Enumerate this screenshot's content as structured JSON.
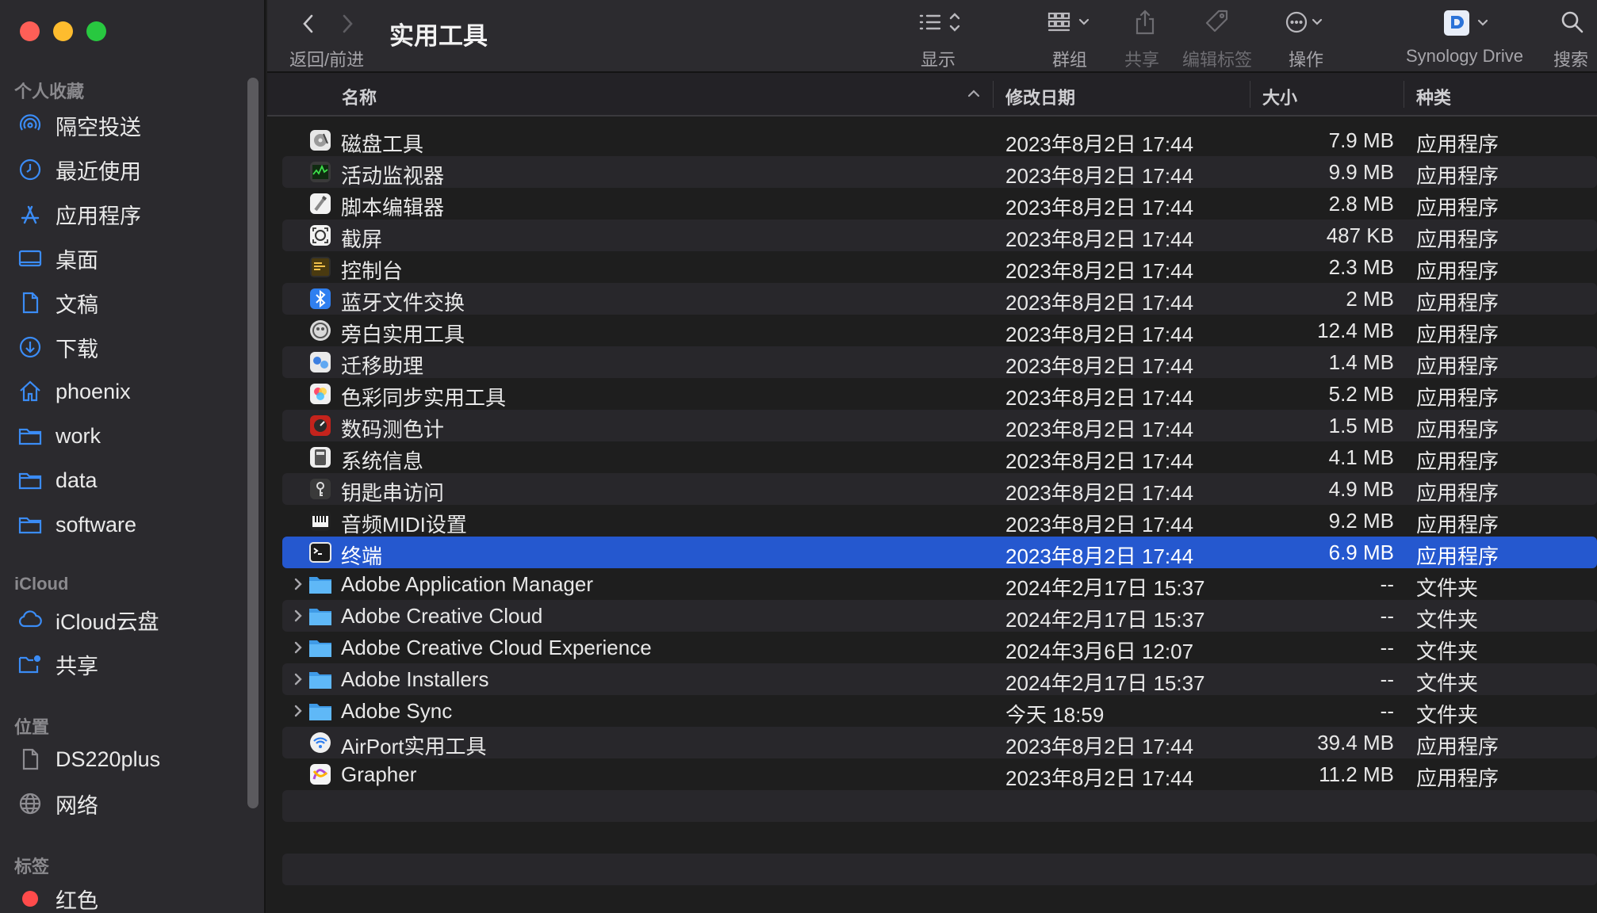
{
  "window": {
    "title": "实用工具",
    "controls": [
      "close",
      "minimize",
      "zoom"
    ]
  },
  "sidebar": {
    "sections": [
      {
        "title": "个人收藏",
        "items": [
          {
            "label": "隔空投送",
            "icon": "airdrop-icon"
          },
          {
            "label": "最近使用",
            "icon": "clock-icon"
          },
          {
            "label": "应用程序",
            "icon": "applications-icon"
          },
          {
            "label": "桌面",
            "icon": "desktop-icon"
          },
          {
            "label": "文稿",
            "icon": "document-icon"
          },
          {
            "label": "下载",
            "icon": "download-icon"
          },
          {
            "label": "phoenix",
            "icon": "home-icon"
          },
          {
            "label": "work",
            "icon": "folder-icon"
          },
          {
            "label": "data",
            "icon": "folder-icon"
          },
          {
            "label": "software",
            "icon": "folder-icon"
          }
        ]
      },
      {
        "title": "iCloud",
        "items": [
          {
            "label": "iCloud云盘",
            "icon": "cloud-icon"
          },
          {
            "label": "共享",
            "icon": "shared-folder-icon"
          }
        ]
      },
      {
        "title": "位置",
        "items": [
          {
            "label": "DS220plus",
            "icon": "document-icon"
          },
          {
            "label": "网络",
            "icon": "globe-icon"
          }
        ]
      },
      {
        "title": "标签",
        "items": [
          {
            "label": "红色",
            "icon": "red-tag-icon",
            "color": "#ff4b4b"
          }
        ]
      }
    ]
  },
  "toolbar": {
    "nav_label": "返回/前进",
    "view_label": "显示",
    "group_label": "群组",
    "share_label": "共享",
    "tags_label": "编辑标签",
    "action_label": "操作",
    "synology_label": "Synology Drive",
    "search_label": "搜索"
  },
  "columns": {
    "name": "名称",
    "date": "修改日期",
    "size": "大小",
    "kind": "种类"
  },
  "colors": {
    "selection": "#2558cf",
    "folder": "#56b4f5",
    "accent": "#3b8cf6"
  },
  "files": [
    {
      "name": "磁盘工具",
      "date": "2023年8月2日 17:44",
      "size": "7.9 MB",
      "kind": "应用程序",
      "icon": "disk-utility-icon"
    },
    {
      "name": "活动监视器",
      "date": "2023年8月2日 17:44",
      "size": "9.9 MB",
      "kind": "应用程序",
      "icon": "activity-monitor-icon"
    },
    {
      "name": "脚本编辑器",
      "date": "2023年8月2日 17:44",
      "size": "2.8 MB",
      "kind": "应用程序",
      "icon": "script-editor-icon"
    },
    {
      "name": "截屏",
      "date": "2023年8月2日 17:44",
      "size": "487 KB",
      "kind": "应用程序",
      "icon": "screenshot-icon"
    },
    {
      "name": "控制台",
      "date": "2023年8月2日 17:44",
      "size": "2.3 MB",
      "kind": "应用程序",
      "icon": "console-icon"
    },
    {
      "name": "蓝牙文件交换",
      "date": "2023年8月2日 17:44",
      "size": "2 MB",
      "kind": "应用程序",
      "icon": "bluetooth-icon"
    },
    {
      "name": "旁白实用工具",
      "date": "2023年8月2日 17:44",
      "size": "12.4 MB",
      "kind": "应用程序",
      "icon": "voiceover-icon"
    },
    {
      "name": "迁移助理",
      "date": "2023年8月2日 17:44",
      "size": "1.4 MB",
      "kind": "应用程序",
      "icon": "migration-assistant-icon"
    },
    {
      "name": "色彩同步实用工具",
      "date": "2023年8月2日 17:44",
      "size": "5.2 MB",
      "kind": "应用程序",
      "icon": "colorsync-icon"
    },
    {
      "name": "数码测色计",
      "date": "2023年8月2日 17:44",
      "size": "1.5 MB",
      "kind": "应用程序",
      "icon": "color-meter-icon"
    },
    {
      "name": "系统信息",
      "date": "2023年8月2日 17:44",
      "size": "4.1 MB",
      "kind": "应用程序",
      "icon": "system-info-icon"
    },
    {
      "name": "钥匙串访问",
      "date": "2023年8月2日 17:44",
      "size": "4.9 MB",
      "kind": "应用程序",
      "icon": "keychain-icon"
    },
    {
      "name": "音频MIDI设置",
      "date": "2023年8月2日 17:44",
      "size": "9.2 MB",
      "kind": "应用程序",
      "icon": "midi-icon"
    },
    {
      "name": "终端",
      "date": "2023年8月2日 17:44",
      "size": "6.9 MB",
      "kind": "应用程序",
      "icon": "terminal-icon",
      "selected": true
    },
    {
      "name": "Adobe Application Manager",
      "date": "2024年2月17日 15:37",
      "size": "--",
      "kind": "文件夹",
      "icon": "folder-icon",
      "folder": true
    },
    {
      "name": "Adobe Creative Cloud",
      "date": "2024年2月17日 15:37",
      "size": "--",
      "kind": "文件夹",
      "icon": "folder-icon",
      "folder": true
    },
    {
      "name": "Adobe Creative Cloud Experience",
      "date": "2024年3月6日 12:07",
      "size": "--",
      "kind": "文件夹",
      "icon": "folder-icon",
      "folder": true
    },
    {
      "name": "Adobe Installers",
      "date": "2024年2月17日 15:37",
      "size": "--",
      "kind": "文件夹",
      "icon": "folder-icon",
      "folder": true
    },
    {
      "name": "Adobe Sync",
      "date": "今天 18:59",
      "size": "--",
      "kind": "文件夹",
      "icon": "folder-icon",
      "folder": true
    },
    {
      "name": "AirPort实用工具",
      "date": "2023年8月2日 17:44",
      "size": "39.4 MB",
      "kind": "应用程序",
      "icon": "airport-icon"
    },
    {
      "name": "Grapher",
      "date": "2023年8月2日 17:44",
      "size": "11.2 MB",
      "kind": "应用程序",
      "icon": "grapher-icon"
    }
  ]
}
